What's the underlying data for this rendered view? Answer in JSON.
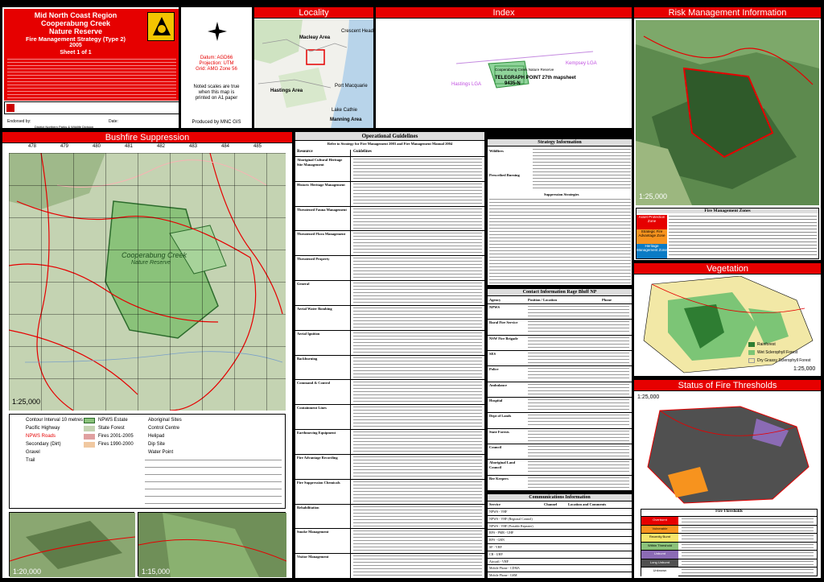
{
  "title_block": {
    "region": "Mid North Coast Region",
    "reserve_name": "Cooperabung Creek",
    "reserve_type": "Nature Reserve",
    "strategy": "Fire Management Strategy (Type 2)",
    "year": "2005",
    "sheet": "Sheet 1 of 1",
    "datum": "Datum: AGD66",
    "projection": "Projection: UTM",
    "grid": "Grid: AMG Zone 56",
    "scale_note_1": "Noted scales are true",
    "scale_note_2": "when this map is",
    "scale_note_3": "printed on A1 paper",
    "produced_by": "Produced by MNC GIS",
    "endorsed_by": "Endorsed by:",
    "date_label": "Date:",
    "signatory": "District Northern Parks & Wildlife Division"
  },
  "locality": {
    "title": "Locality",
    "labels": [
      "Macleay Area",
      "Hastings Area",
      "Port Macquarie",
      "Crescent Head",
      "Lake Cathie",
      "Manning Area"
    ]
  },
  "index": {
    "title": "Index",
    "labels": [
      "Kempsey LGA",
      "Hastings LGA",
      "TELEGRAPH POINT 27th mapsheet",
      "9435-N",
      "Cooperabung Creek Nature Reserve"
    ]
  },
  "risk": {
    "title": "Risk Management Information",
    "scale": "1:25,000",
    "legend_title": "Fire Management Zones",
    "zones": [
      "Asset Protection Zone",
      "Strategic Fire Advantage Zone",
      "Heritage Management Zone"
    ]
  },
  "bushfire": {
    "title": "Bushfire Suppression",
    "scale": "1:25,000",
    "reserve_label_1": "Cooperabung Creek",
    "reserve_label_2": "Nature Reserve",
    "top_ticks": [
      "478",
      "479",
      "480",
      "481",
      "482",
      "483",
      "484",
      "485"
    ],
    "legend": [
      "Contour Interval 10 metres",
      "Pacific Highway",
      "NPWS Roads",
      "Secondary (Dirt)",
      "Gravel",
      "Trail",
      "NPWS Estate",
      "State Forest",
      "Fires 2001-2005",
      "Fires 1990-2000",
      "Aboriginal Sites",
      "Control Centre",
      "Helipad",
      "Dip Site",
      "Water Point"
    ],
    "inset_left_scale": "1:20,000",
    "inset_right_scale": "1:15,000"
  },
  "ops": {
    "title": "Operational Guidelines",
    "subtitle": "Refer to Strategy for Fire Management 2003 and Fire Management Manual 2004",
    "col1": "Resource",
    "col2": "Guidelines",
    "rows": [
      "Aboriginal Cultural Heritage Site Management",
      "Historic Heritage Management",
      "Threatened Fauna Management",
      "Threatened Flora Management",
      "Threatened Property",
      "General",
      "Aerial Water Bombing",
      "Aerial Ignition",
      "Backburning",
      "Command & Control",
      "Containment Lines",
      "Earthmoving Equipment",
      "Fire Advantage Recording",
      "Fire Suppression Chemicals",
      "Rehabilitation",
      "Smoke Management",
      "Visitor Management"
    ]
  },
  "strategy": {
    "title": "Strategy Information",
    "rows": [
      "Wildfires",
      "Prescribed Burning",
      "Suppression Strategies"
    ]
  },
  "contacts": {
    "title": "Contact Information Rage Bluff NP",
    "cols": [
      "Agency",
      "Position / Location",
      "Phone"
    ],
    "agencies": [
      "NPWS",
      "Rural Fire Service",
      "NSW Fire Brigade",
      "SES",
      "Police",
      "Ambulance",
      "Hospital",
      "Dept of Lands",
      "State Forests",
      "Council",
      "Aboriginal Land Council",
      "Bee Keepers"
    ]
  },
  "comms": {
    "title": "Communications Information",
    "cols": [
      "Service",
      "Channel",
      "Location and Comments"
    ],
    "services": [
      "NPWS - VHF",
      "NPWS - VHF (Regional Control)",
      "NPWS - VHF (Portable Repeater)",
      "RFS - PMR - UHF",
      "RFS - GRN",
      "SF - VHF",
      "CB - UHF",
      "Aircraft - VHF",
      "Mobile Phone - CDMA",
      "Mobile Phone - GSM"
    ]
  },
  "vegetation": {
    "title": "Vegetation",
    "scale": "1:25,000",
    "legend": [
      "Rainforest",
      "Wet Sclerophyll Forest",
      "Dry Grassy Sclerophyll Forest"
    ]
  },
  "thresholds": {
    "title": "Status of Fire Thresholds",
    "scale": "1:25,000",
    "legend_title": "Fire Thresholds",
    "classes": [
      "Overburnt",
      "Vulnerable",
      "Recently Burnt",
      "Within Threshold",
      "Unburnt",
      "Long Unburnt",
      "Unknown"
    ]
  },
  "colors": {
    "accent": "#e60000",
    "reserve": "#8ac27a",
    "rainforest": "#2e7d32",
    "wet_sclerophyll": "#7cc576",
    "dry_sclerophyll": "#f2e8a6",
    "threshold_dark": "#505050"
  }
}
